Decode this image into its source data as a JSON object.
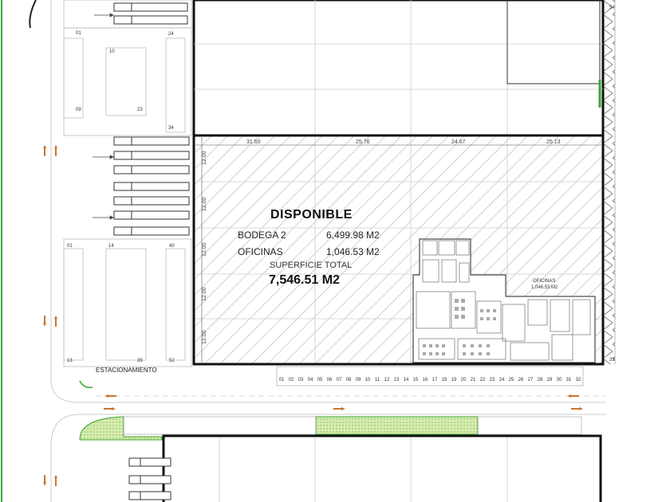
{
  "warehouse": {
    "status": "DISPONIBLE",
    "bodega_label": "BODEGA 2",
    "bodega_area": "6,499.98 M2",
    "oficinas_label": "OFICINAS",
    "oficinas_area": "1,046.53 M2",
    "total_label": "SUPERFICIE TOTAL",
    "total_area": "7,546.51 M2"
  },
  "office_block": {
    "label": "OFICINAS",
    "area": "1,046.53 M2"
  },
  "dimensions": {
    "horizontal": [
      "31.60",
      "25.76",
      "24.67",
      "25.13"
    ],
    "vertical": [
      "12.00",
      "12.00",
      "12.00",
      "12.00",
      "12.00"
    ]
  },
  "parking": {
    "label": "ESTACIONAMIENTO",
    "upper_stalls": [
      "01",
      "24",
      "10",
      "09",
      "23",
      "34"
    ],
    "lower_stalls": [
      "01",
      "14",
      "40",
      "13",
      "39",
      "52"
    ]
  },
  "docks": [
    "01",
    "02",
    "03",
    "04",
    "05",
    "06",
    "07",
    "08",
    "09",
    "10",
    "11",
    "12",
    "13",
    "14",
    "15",
    "16",
    "17",
    "18",
    "19",
    "20",
    "21",
    "22",
    "23",
    "24",
    "25",
    "26",
    "27",
    "28",
    "29",
    "30",
    "31",
    "32"
  ],
  "side_numbers": [
    "54",
    "33"
  ],
  "colors": {
    "wall": "#111111",
    "grid": "#cccccc",
    "hatch": "#9aa6b8",
    "green_area": "#cfe8a8",
    "green_line": "#3fa535",
    "arrow": "#c8762e"
  }
}
